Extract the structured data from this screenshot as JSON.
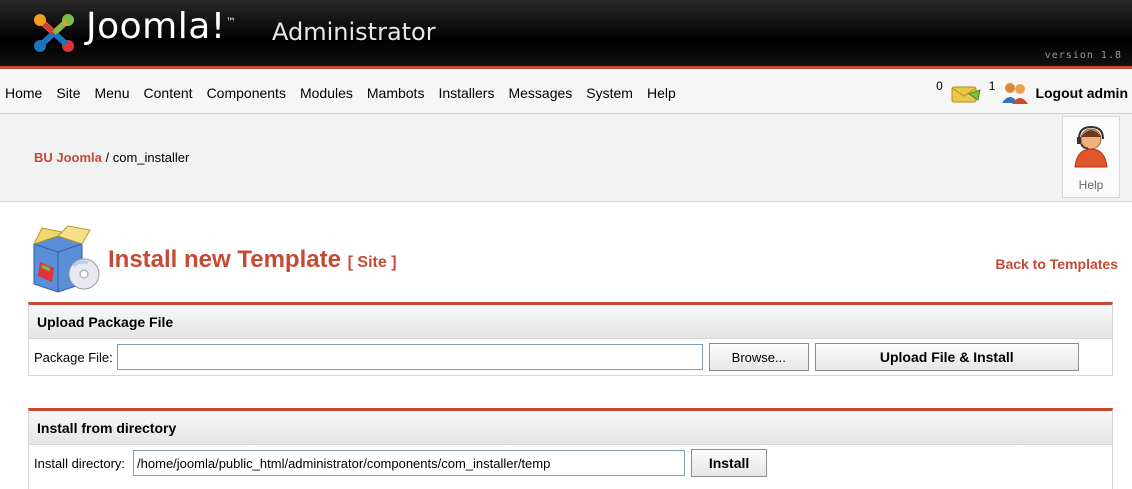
{
  "header": {
    "logo_text": "Joomla!",
    "logo_tm": "™",
    "admin_text": "Administrator",
    "version": "version 1.8",
    "accent_color": "#c64934"
  },
  "menu": {
    "items": [
      "Home",
      "Site",
      "Menu",
      "Content",
      "Components",
      "Modules",
      "Mambots",
      "Installers",
      "Messages",
      "System",
      "Help"
    ]
  },
  "status": {
    "messages_count": "0",
    "users_count": "1",
    "logout_label": "Logout admin",
    "messages_icon": "mail-icon",
    "users_icon": "users-icon"
  },
  "pathway": {
    "site": "BU Joomla",
    "separator": " / ",
    "current": "com_installer"
  },
  "toolbar": {
    "help_label": "Help",
    "help_icon": "support-agent-icon"
  },
  "page": {
    "title": "Install new Template",
    "title_suffix": "[ Site ]",
    "back_link": "Back to Templates",
    "title_icon": "install-package-icon"
  },
  "upload": {
    "section_title": "Upload Package File",
    "field_label": "Package File:",
    "field_value": "",
    "browse_label": "Browse...",
    "submit_label": "Upload File & Install"
  },
  "directory": {
    "section_title": "Install from directory",
    "field_label": "Install directory:",
    "field_value": "/home/joomla/public_html/administrator/components/com_installer/temp",
    "submit_label": "Install"
  }
}
